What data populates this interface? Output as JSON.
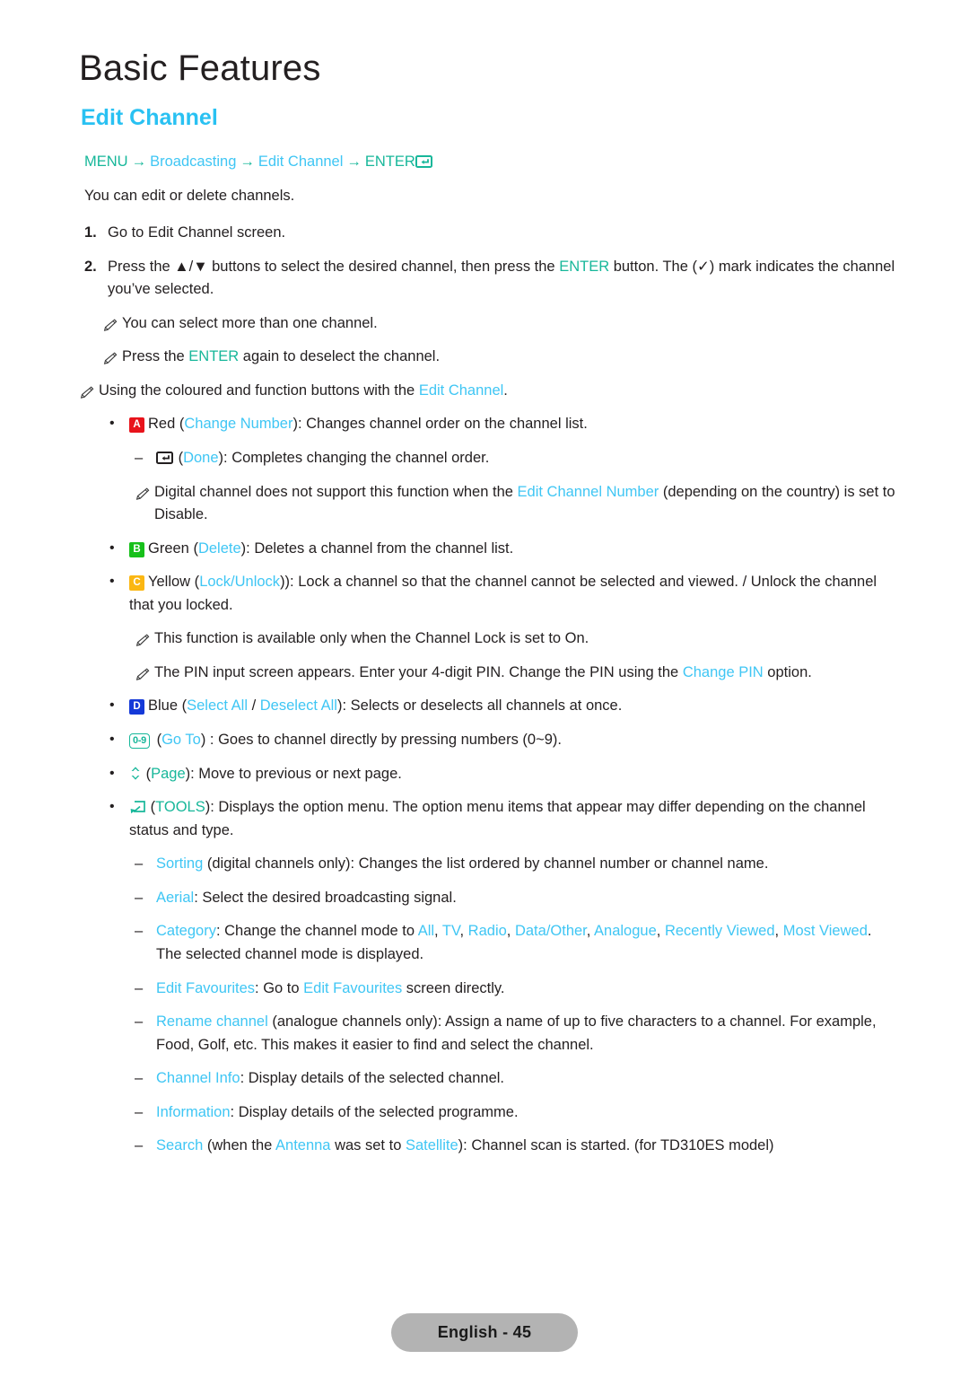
{
  "header": {
    "chapter_title": "Basic Features",
    "section_title": "Edit Channel"
  },
  "menu_path": {
    "menu": "MENU",
    "arrow": "→",
    "broadcasting": "Broadcasting",
    "edit_channel": "Edit Channel",
    "enter": "ENTER",
    "enter_icon": "enter-return-icon"
  },
  "intro": "You can edit or delete channels.",
  "steps": [
    {
      "num": "1.",
      "text": "Go to Edit Channel screen."
    },
    {
      "num": "2.",
      "prefix": "Press the ▲/▼ buttons to select the desired channel, then press the ",
      "enter": "ENTER",
      "mid": " button. The (",
      "check": "✓",
      "suffix": ") mark indicates the channel you’ve selected."
    }
  ],
  "notes_top": [
    "You can select more than one channel.",
    {
      "prefix": "Press the ",
      "enter": "ENTER",
      "suffix": " again to deselect the channel."
    }
  ],
  "coloured_intro": {
    "prefix": "Using the coloured and function buttons with the ",
    "link": "Edit Channel",
    "suffix": "."
  },
  "buttons": {
    "red": {
      "badge": "A",
      "badge_color": "#e8131b",
      "name": "Red",
      "open": " (",
      "link": "Change Number",
      "close": "): Changes channel order on the channel list.",
      "sub_dash": {
        "icon": "enter-return-icon-dark",
        "open": "(",
        "link": "Done",
        "close": "): Completes changing the channel order."
      },
      "sub_note": {
        "prefix": "Digital channel does not support this function when the ",
        "link": "Edit Channel Number",
        "suffix": " (depending on the country) is set to Disable."
      }
    },
    "green": {
      "badge": "B",
      "badge_color": "#17c01a",
      "name": "Green",
      "open": " (",
      "link": "Delete",
      "close": "): Deletes a channel from the channel list."
    },
    "yellow": {
      "badge": "C",
      "badge_color": "#fbb713",
      "name": "Yellow",
      "open": " (",
      "link": "Lock/Unlock",
      "close": ")): Lock a channel so that the channel cannot be selected and viewed. / Unlock the channel that you locked.",
      "note1": "This function is available only when the Channel Lock is set to On.",
      "note2": {
        "prefix": "The PIN input screen appears. Enter your 4-digit PIN. Change the PIN using the ",
        "link": "Change PIN",
        "suffix": " option."
      }
    },
    "blue": {
      "badge": "D",
      "badge_color": "#1439d8",
      "name": "Blue",
      "open": " (",
      "link1": "Select All",
      "slash": " / ",
      "link2": "Deselect All",
      "close": "): Selects or deselects all channels at once."
    },
    "goto": {
      "badge": "0~9",
      "badge_label": "0-9",
      "open": " (",
      "link": "Go To",
      "close": ") : Goes to channel directly by pressing numbers (0~9)."
    },
    "page": {
      "icon": "updown-chevron-icon",
      "open": " (",
      "link": "Page",
      "close": "): Move to previous or next page."
    },
    "tools": {
      "icon": "tools-arrow-icon",
      "open": " (",
      "link": "TOOLS",
      "close": "): Displays the option menu. The option menu items that appear may differ depending on the channel status and type."
    }
  },
  "tools_options": [
    {
      "link": "Sorting",
      "text": " (digital channels only): Changes the list ordered by channel number or channel name."
    },
    {
      "link": "Aerial",
      "text": ": Select the desired broadcasting signal."
    },
    {
      "link": "Category",
      "text": ": Change the channel mode to ",
      "modes": [
        "All",
        "TV",
        "Radio",
        "Data/Other",
        "Analogue",
        "Recently Viewed",
        "Most Viewed"
      ],
      "tail": ". The selected channel mode is displayed."
    },
    {
      "link": "Edit Favourites",
      "text": ": Go to ",
      "link2": "Edit Favourites",
      "tail": " screen directly."
    },
    {
      "link": "Rename channel",
      "text": " (analogue channels only): Assign a name of up to five characters to a channel. For example, Food, Golf, etc. This makes it easier to find and select the channel."
    },
    {
      "link": "Channel Info",
      "text": ": Display details of the selected channel."
    },
    {
      "link": "Information",
      "text": ": Display details of the selected programme."
    },
    {
      "link": "Search",
      "text": " (when the ",
      "link2": "Antenna",
      "mid": " was set to ",
      "link3": "Satellite",
      "tail": "): Channel scan is started. (for TD310ES model)"
    }
  ],
  "footer": {
    "page_label": "English - 45"
  },
  "colors": {
    "cyan_link": "#3fc6f4",
    "teal": "#17b79a",
    "heading_cyan": "#29c1f2",
    "body_text": "#231f20",
    "footer_pill": "#b3b3b3"
  }
}
